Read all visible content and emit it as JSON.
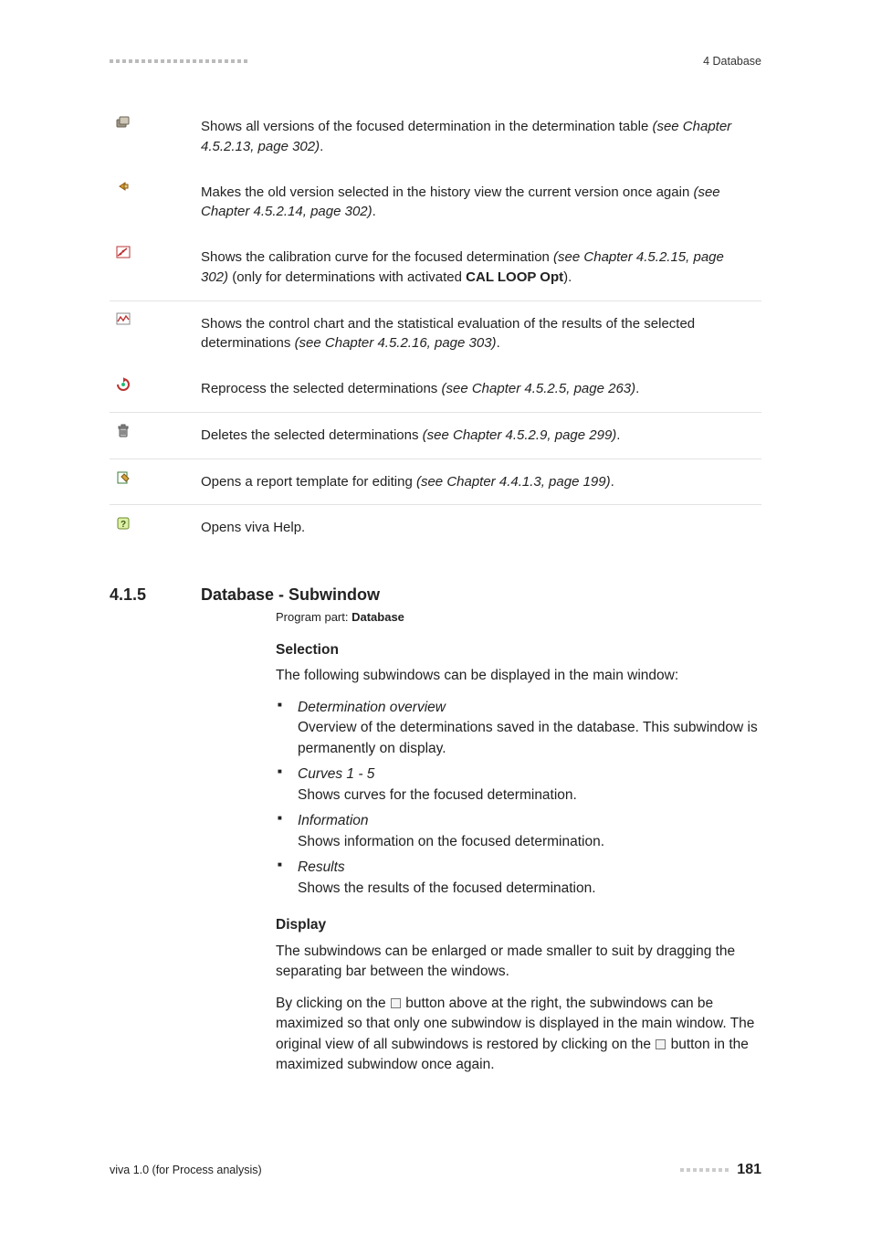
{
  "header": {
    "right_label": "4 Database"
  },
  "icon_rows": [
    {
      "icon": "versions-icon",
      "text": "Shows all versions of the focused determination in the determination table ",
      "ital": "(see Chapter 4.5.2.13, page 302)",
      "tail": ".",
      "sep": false
    },
    {
      "icon": "restore-version-icon",
      "text": "Makes the old version selected in the history view the current version once again ",
      "ital": "(see Chapter 4.5.2.14, page 302)",
      "tail": ".",
      "sep": false
    },
    {
      "icon": "calibration-curve-icon",
      "text": "Shows the calibration curve for the focused determination ",
      "ital": "(see Chapter 4.5.2.15, page 302)",
      "tail2_pre": " (only for determinations with activated ",
      "bold": "CAL LOOP Opt",
      "tail2_post": ").",
      "sep": false
    },
    {
      "icon": "control-chart-icon",
      "text": "Shows the control chart and the statistical evaluation of the results of the selected determinations ",
      "ital": "(see Chapter 4.5.2.16, page 303)",
      "tail": ".",
      "sep": true
    },
    {
      "icon": "reprocess-icon",
      "text": "Reprocess the selected determinations ",
      "ital": "(see Chapter 4.5.2.5, page 263)",
      "tail": ".",
      "sep": false
    },
    {
      "icon": "delete-icon",
      "text": "Deletes the selected determinations ",
      "ital": "(see Chapter 4.5.2.9, page 299)",
      "tail": ".",
      "sep": true
    },
    {
      "icon": "edit-template-icon",
      "text": "Opens a report template for editing ",
      "ital": "(see Chapter 4.4.1.3, page 199)",
      "tail": ".",
      "sep": true
    },
    {
      "icon": "help-icon",
      "text": "Opens viva Help.",
      "ital": "",
      "tail": "",
      "sep": true
    }
  ],
  "section": {
    "number": "4.1.5",
    "title": "Database - Subwindow",
    "program_part_label": "Program part: ",
    "program_part_value": "Database",
    "selection_head": "Selection",
    "selection_intro": "The following subwindows can be displayed in the main window:",
    "items": [
      {
        "term": "Determination overview",
        "desc": "Overview of the determinations saved in the database. This subwindow is permanently on display."
      },
      {
        "term": "Curves 1 - 5",
        "desc": "Shows curves for the focused determination."
      },
      {
        "term": "Information",
        "desc": "Shows information on the focused determination."
      },
      {
        "term": "Results",
        "desc": "Shows the results of the focused determination."
      }
    ],
    "display_head": "Display",
    "display_p1": "The subwindows can be enlarged or made smaller to suit by dragging the separating bar between the windows.",
    "display_p2a": "By clicking on the ",
    "display_p2b": " button above at the right, the subwindows can be maximized so that only one subwindow is displayed in the main window. The original view of all subwindows is restored by clicking on the ",
    "display_p2c": " button in the maximized subwindow once again."
  },
  "footer": {
    "left": "viva 1.0 (for Process analysis)",
    "page": "181"
  }
}
